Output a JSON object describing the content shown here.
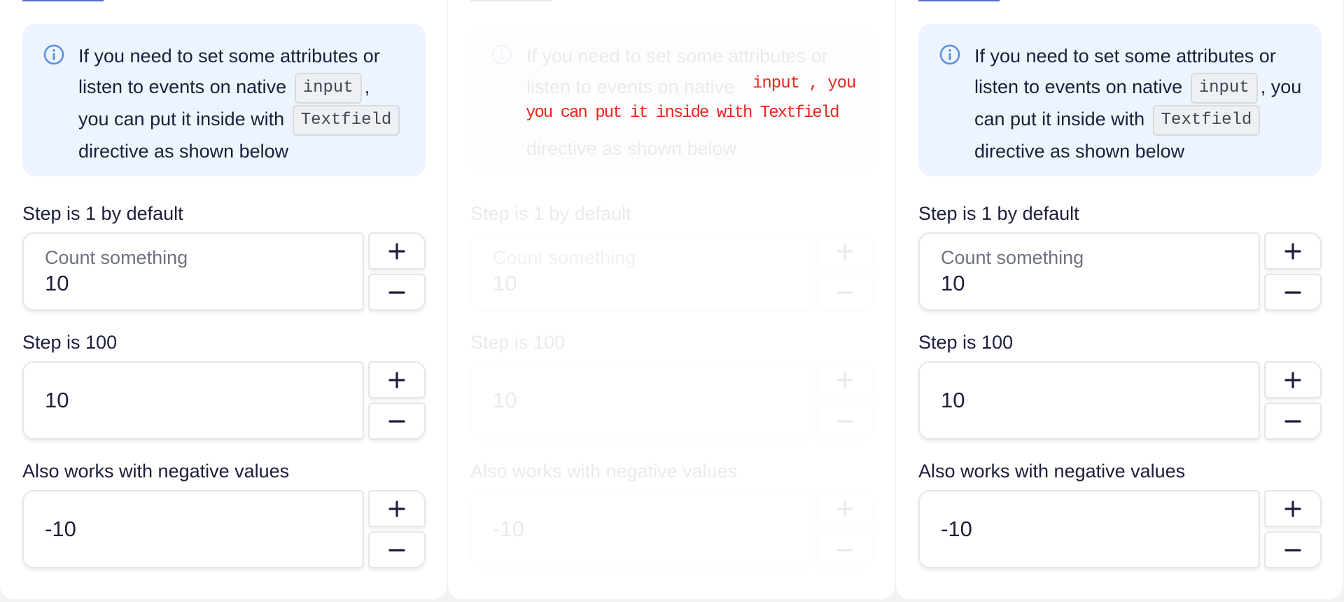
{
  "notice": {
    "line1": "If you need to set some attributes or",
    "line2_prefix": "listen to events on native",
    "code_input": "input",
    "line2_suffix": ",",
    "line3_prefix": "you can put it inside with",
    "code_textfield": "Textfield",
    "line4": "directive as shown below",
    "icon": "info-icon"
  },
  "notice_alt": {
    "line1": "If you need to set some attributes or",
    "line2_prefix": "listen to events on native",
    "code_input": "input",
    "line2_suffix": ", you",
    "line3_prefix": "can put it inside with",
    "code_textfield": "Textfield",
    "line4": "directive as shown below"
  },
  "glitch": {
    "top": "input , you",
    "bottom": "you can put it inside with Textfield"
  },
  "steppers": [
    {
      "label": "Step is 1 by default",
      "placeholder": "Count something",
      "value": "10"
    },
    {
      "label": "Step is 100",
      "placeholder": "",
      "value": "10"
    },
    {
      "label": "Also works with negative values",
      "placeholder": "",
      "value": "-10"
    }
  ],
  "icons": {
    "plus": "plus-icon",
    "minus": "minus-icon"
  },
  "colors": {
    "accent": "#526ed3",
    "notice_bg": "#edf4fe",
    "glitch": "#e8251d"
  }
}
